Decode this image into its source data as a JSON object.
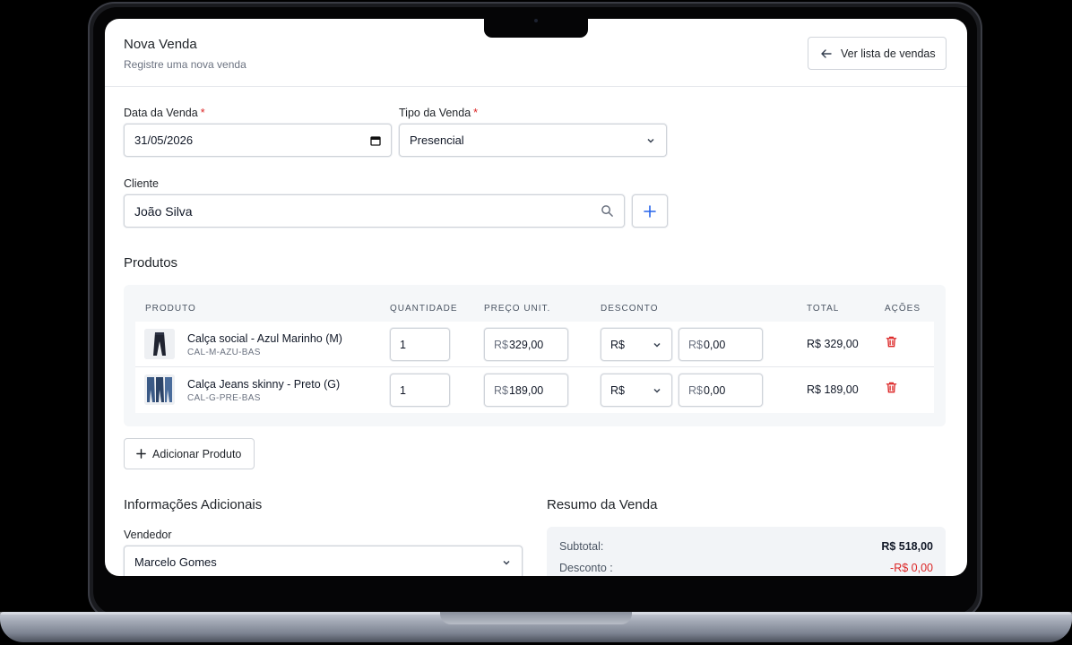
{
  "header": {
    "title": "Nova Venda",
    "subtitle": "Registre uma nova venda",
    "back_button": "Ver lista de vendas"
  },
  "form": {
    "date": {
      "label": "Data da Venda",
      "required_mark": "*",
      "value": "31/05/2026"
    },
    "type": {
      "label": "Tipo da Venda",
      "required_mark": "*",
      "value": "Presencial"
    },
    "client": {
      "label": "Cliente",
      "value": "João Silva"
    }
  },
  "products": {
    "title": "Produtos",
    "columns": [
      "PRODUTO",
      "QUANTIDADE",
      "PREÇO UNIT.",
      "DESCONTO",
      "TOTAL",
      "AÇÕES"
    ],
    "rows": [
      {
        "name": "Calça social - Azul Marinho (M)",
        "sku": "CAL-M-AZU-BAS",
        "quantity": "1",
        "currency": "R$",
        "unit_price": "329,00",
        "discount_type": "R$",
        "discount_value": "0,00",
        "total": "R$ 329,00",
        "thumb_color": "#1f2330"
      },
      {
        "name": "Calça Jeans skinny - Preto (G)",
        "sku": "CAL-G-PRE-BAS",
        "quantity": "1",
        "currency": "R$",
        "unit_price": "189,00",
        "discount_type": "R$",
        "discount_value": "0,00",
        "total": "R$ 189,00",
        "thumb_color": "#3b5a86"
      }
    ],
    "add_button": "Adicionar Produto"
  },
  "additional": {
    "title": "Informações Adicionais",
    "seller_label": "Vendedor",
    "seller_value": "Marcelo Gomes"
  },
  "summary": {
    "title": "Resumo da Venda",
    "subtotal_label": "Subtotal:",
    "subtotal_value": "R$ 518,00",
    "discount_label": "Desconto :",
    "discount_value": "-R$ 0,00"
  },
  "colors": {
    "accent": "#2563eb",
    "danger": "#dc2626"
  }
}
